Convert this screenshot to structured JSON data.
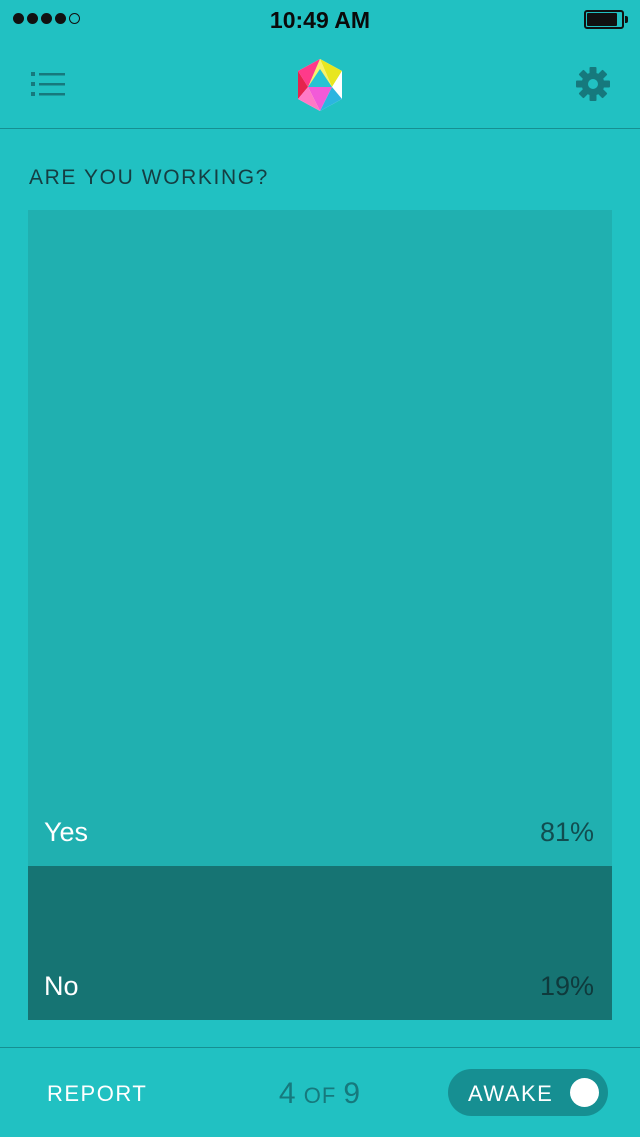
{
  "status_bar": {
    "time": "10:49 AM",
    "signal": {
      "filled": 4,
      "total": 5
    }
  },
  "nav": {
    "menu_icon": "list-icon",
    "logo_icon": "icosahedron-logo",
    "settings_icon": "gear-icon"
  },
  "question": "ARE YOU WORKING?",
  "chart_data": {
    "type": "bar",
    "categories": [
      "Yes",
      "No"
    ],
    "values": [
      81,
      19
    ],
    "value_labels": [
      "81%",
      "19%"
    ],
    "colors": [
      "#20b0b0",
      "#167473"
    ]
  },
  "footer": {
    "report_label": "REPORT",
    "pager": {
      "current": "4",
      "of": "OF",
      "total": "9"
    },
    "awake_label": "AWAKE",
    "awake_on": true
  },
  "colors": {
    "background": "#21c1c2",
    "divider": "#168f92"
  }
}
